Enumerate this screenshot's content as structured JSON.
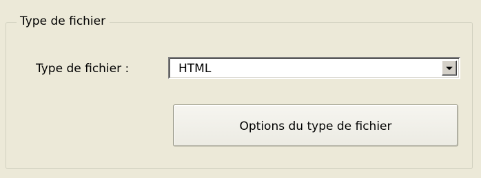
{
  "file_type_group": {
    "title": "Type de fichier",
    "field_label": "Type de fichier :",
    "selected_type": "HTML",
    "options_button_label": "Options du type de fichier"
  },
  "icons": {
    "dropdown": "chevron-down-icon"
  }
}
